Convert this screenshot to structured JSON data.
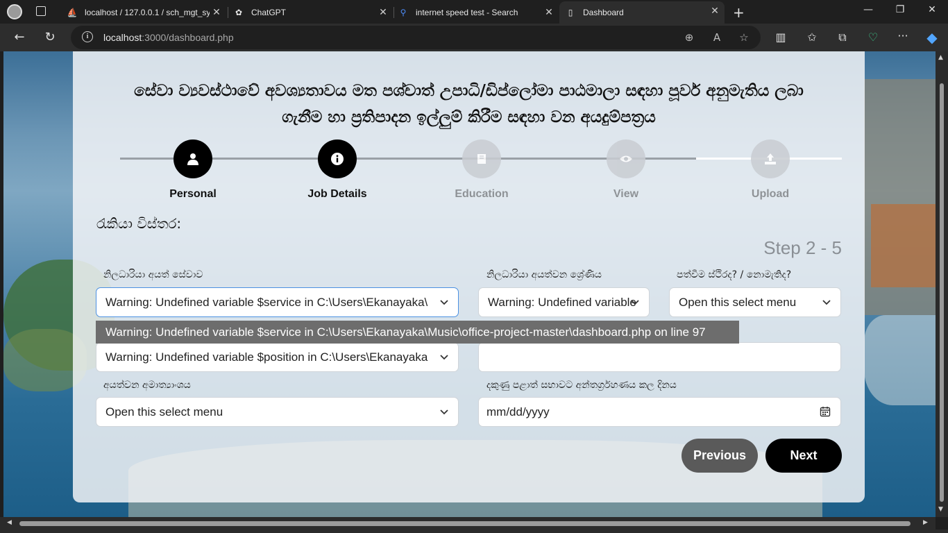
{
  "browser": {
    "tabs": [
      {
        "title": "localhost / 127.0.0.1 / sch_mgt_sy",
        "icon": "phpmyadmin-icon"
      },
      {
        "title": "ChatGPT",
        "icon": "chatgpt-icon"
      },
      {
        "title": "internet speed test - Search",
        "icon": "search-icon"
      },
      {
        "title": "Dashboard",
        "icon": "document-icon"
      }
    ],
    "address": {
      "host": "localhost",
      "path": ":3000/dashboard.php"
    }
  },
  "form": {
    "title": "සේවා ව්‍යවස්ථාවේ අවශ්‍යතාවය මත පශ්චාත් උපාධි/ඩිප්ලෝමා පාඨමාලා සඳහා පූර්ව අනුමැතිය ලබා ගැනීම හා ප්‍රතිපාදන ඉල්ලුම් කිරීම සඳහා වන අයදුම්පත්‍රය",
    "steps": [
      {
        "label": "Personal",
        "state": "active",
        "icon": "user-icon"
      },
      {
        "label": "Job Details",
        "state": "active",
        "icon": "info-icon"
      },
      {
        "label": "Education",
        "state": "inactive",
        "icon": "book-icon"
      },
      {
        "label": "View",
        "state": "inactive",
        "icon": "eye-icon"
      },
      {
        "label": "Upload",
        "state": "inactive",
        "icon": "upload-icon"
      }
    ],
    "section_title": "රැකියා විස්තර:",
    "step_count": "Step 2 - 5",
    "fields": {
      "service_label": "නිලධාරියා අයත් සේවාව",
      "service_value": "Warning: Undefined variable $service in C:\\Users\\Ekanayaka\\",
      "grade_label": "නිලධාරියා අයත්වන ශ්‍රේණිය",
      "grade_value": "Warning: Undefined variable",
      "confirm_label": "පත්වීම ස්ථිරද? / නොමැතිද?",
      "confirm_value": "Open this select menu",
      "dropdown_option": "Warning: Undefined variable $service in C:\\Users\\Ekanayaka\\Music\\office-project-master\\dashboard.php on line 97",
      "position_value": "Warning: Undefined variable $position in C:\\Users\\Ekanayaka",
      "text_value": "",
      "ministry_label": "අයත්වන අමාත්‍යාංශය",
      "ministry_value": "Open this select menu",
      "date_label": "දකුණු පළාත් සභාවට අන්තර්ග්‍රහණය කල දිනය",
      "date_value": "mm/dd/yyyy"
    },
    "buttons": {
      "previous": "Previous",
      "next": "Next"
    }
  }
}
